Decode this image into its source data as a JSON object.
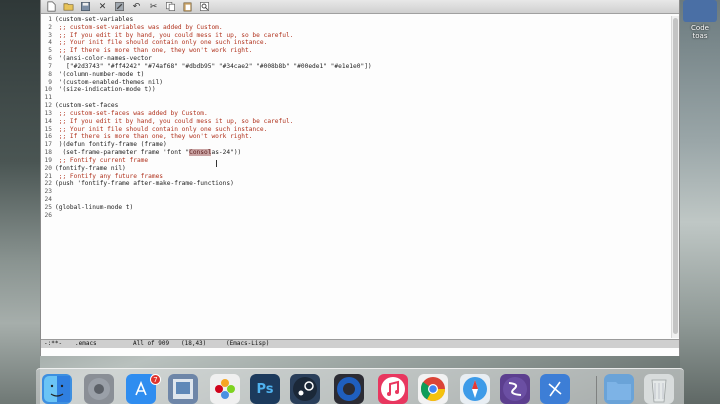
{
  "desktop": {
    "icon_label": "Code\ntoas"
  },
  "toolbar": {
    "buttons": [
      {
        "name": "new-file-icon",
        "glyph": ""
      },
      {
        "name": "open-folder-icon",
        "glyph": ""
      },
      {
        "name": "save-icon",
        "glyph": ""
      },
      {
        "name": "close-icon",
        "glyph": "✕"
      },
      {
        "name": "save-as-icon",
        "glyph": ""
      },
      {
        "name": "undo-icon",
        "glyph": "↶"
      },
      {
        "name": "cut-icon",
        "glyph": "✂"
      },
      {
        "name": "copy-icon",
        "glyph": ""
      },
      {
        "name": "paste-icon",
        "glyph": ""
      },
      {
        "name": "search-icon",
        "glyph": ""
      }
    ]
  },
  "editor": {
    "lines": [
      {
        "n": "1",
        "text": "(custom-set-variables"
      },
      {
        "n": "2",
        "text": " ;; custom-set-variables was added by Custom.",
        "cls": "c-comment"
      },
      {
        "n": "3",
        "text": " ;; If you edit it by hand, you could mess it up, so be careful.",
        "cls": "c-comment"
      },
      {
        "n": "4",
        "text": " ;; Your init file should contain only one such instance.",
        "cls": "c-comment"
      },
      {
        "n": "5",
        "text": " ;; If there is more than one, they won't work right.",
        "cls": "c-comment"
      },
      {
        "n": "6",
        "text": " '(ansi-color-names-vector"
      },
      {
        "n": "7",
        "text": "   [\"#2d3743\" \"#ff4242\" \"#74af68\" \"#dbdb95\" \"#34cae2\" \"#008b8b\" \"#00ede1\" \"#e1e1e0\"])"
      },
      {
        "n": "8",
        "text": " '(column-number-mode t)"
      },
      {
        "n": "9",
        "text": " '(custom-enabled-themes nil)"
      },
      {
        "n": "10",
        "text": " '(size-indication-mode t))"
      },
      {
        "n": "11",
        "text": ""
      },
      {
        "n": "12",
        "text": "(custom-set-faces"
      },
      {
        "n": "13",
        "text": " ;; custom-set-faces was added by Custom.",
        "cls": "c-comment"
      },
      {
        "n": "14",
        "text": " ;; If you edit it by hand, you could mess it up, so be careful.",
        "cls": "c-comment"
      },
      {
        "n": "15",
        "text": " ;; Your init file should contain only one such instance.",
        "cls": "c-comment"
      },
      {
        "n": "16",
        "text": " ;; If there is more than one, they won't work right.",
        "cls": "c-comment"
      },
      {
        "n": "17",
        "text": " )(defun fontify-frame (frame)"
      },
      {
        "n": "18",
        "pre": "  (set-frame-parameter frame 'font \"",
        "hl": "Consol",
        "post": "as-24\"))"
      },
      {
        "n": "19",
        "text": " ;; Fontify current frame",
        "cls": "c-comment"
      },
      {
        "n": "20",
        "text": "(fontify-frame nil)"
      },
      {
        "n": "21",
        "text": " ;; Fontify any future frames",
        "cls": "c-comment"
      },
      {
        "n": "22",
        "text": "(push 'fontify-frame after-make-frame-functions)"
      },
      {
        "n": "23",
        "text": ""
      },
      {
        "n": "24",
        "text": ""
      },
      {
        "n": "25",
        "text": "(global-linum-mode t)"
      },
      {
        "n": "26",
        "text": ""
      }
    ]
  },
  "modeline": {
    "status": "-:**-",
    "buffer": ".emacs",
    "position": "All of 909",
    "cursor": "(18,43)",
    "mode": "(Emacs-Lisp)"
  },
  "dock": {
    "items": [
      {
        "name": "finder-icon",
        "color": "#3d8fe0"
      },
      {
        "name": "system-preferences-icon",
        "color": "#8a8f96"
      },
      {
        "name": "app-store-icon",
        "color": "#2f8df0"
      },
      {
        "name": "preview-icon",
        "color": "#6e86a8"
      },
      {
        "name": "photos-icon",
        "color": "#f0f0f0"
      },
      {
        "name": "photoshop-icon",
        "color": "#1c3a5c",
        "label": "Ps"
      },
      {
        "name": "steam-icon",
        "color": "#2a3f5a"
      },
      {
        "name": "quicktime-icon",
        "color": "#2c2c34"
      },
      {
        "name": "itunes-icon",
        "color": "#e8375f"
      },
      {
        "name": "chrome-icon",
        "color": "#f2f2f2"
      },
      {
        "name": "safari-icon",
        "color": "#e8eef3"
      },
      {
        "name": "emacs-icon",
        "color": "#5c3f8f"
      },
      {
        "name": "xcode-icon",
        "color": "#3d7ed6"
      },
      {
        "name": "folder-icon",
        "color": "#6aa3d8"
      },
      {
        "name": "trash-icon",
        "color": "#d8dcdc"
      }
    ],
    "badge": "7"
  }
}
